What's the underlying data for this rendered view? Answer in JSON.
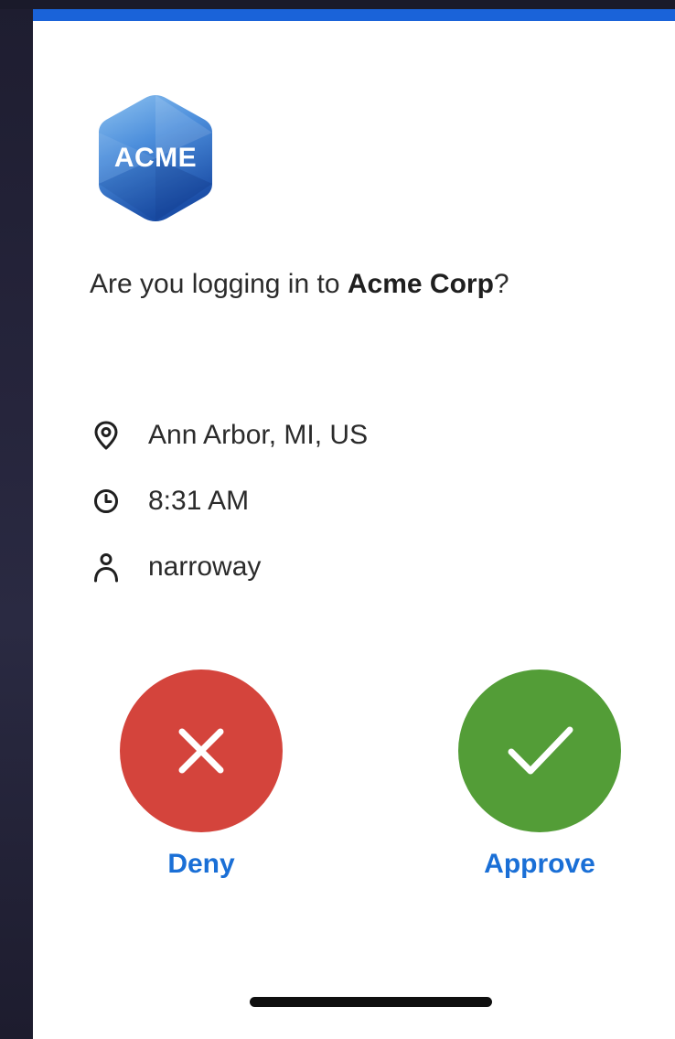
{
  "app": {
    "logo_text": "ACME",
    "accent_color": "#1a63d9"
  },
  "prompt": {
    "prefix": "Are you logging in to ",
    "org": "Acme Corp",
    "suffix": "?"
  },
  "details": [
    {
      "icon": "location-pin-icon",
      "text": "Ann Arbor, MI, US"
    },
    {
      "icon": "clock-icon",
      "text": "8:31 AM"
    },
    {
      "icon": "user-icon",
      "text": "narroway"
    }
  ],
  "actions": {
    "deny_label": "Deny",
    "approve_label": "Approve",
    "deny_color": "#d4443c",
    "approve_color": "#539d37",
    "label_color": "#1a6fd6"
  }
}
